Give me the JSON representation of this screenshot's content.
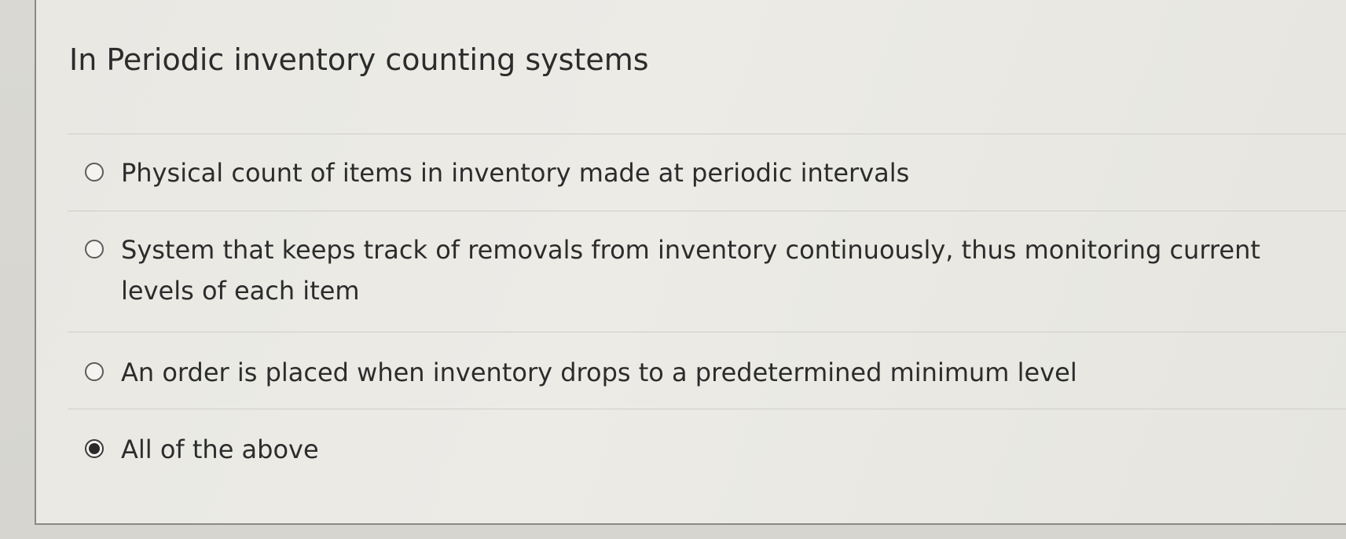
{
  "question": {
    "title": "In Periodic inventory counting systems"
  },
  "options": [
    {
      "label": "Physical count of items in inventory made at periodic intervals",
      "selected": false
    },
    {
      "label": "System that keeps track of removals from inventory continuously, thus monitoring current levels of each item",
      "selected": false
    },
    {
      "label": "An order is placed when inventory drops to a predetermined minimum level",
      "selected": false
    },
    {
      "label": "All of the above",
      "selected": true
    }
  ]
}
